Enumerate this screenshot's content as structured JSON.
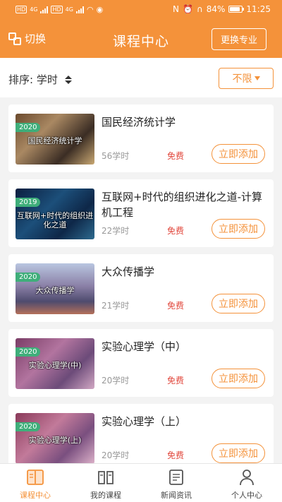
{
  "status_bar": {
    "left_network_labels": [
      "HD",
      "4G",
      "HD",
      "4G"
    ],
    "battery": "84%",
    "time": "11:25"
  },
  "header": {
    "switch_label": "切换",
    "title": "课程中心",
    "change_major_label": "更换专业"
  },
  "sort": {
    "label": "排序: 学时",
    "filter_label": "不限"
  },
  "courses": [
    {
      "year": "2020",
      "thumb_text": "国民经济统计学",
      "title": "国民经济统计学",
      "hours": "56学时",
      "price": "免费",
      "action": "立即添加"
    },
    {
      "year": "2019",
      "thumb_text": "互联网+时代的组织进化之道",
      "title": "互联网+时代的组织进化之道-计算机工程",
      "hours": "22学时",
      "price": "免费",
      "action": "立即添加"
    },
    {
      "year": "2020",
      "thumb_text": "大众传播学",
      "title": "大众传播学",
      "hours": "21学时",
      "price": "免费",
      "action": "立即添加"
    },
    {
      "year": "2020",
      "thumb_text": "实验心理学(中)",
      "title": "实验心理学（中）",
      "hours": "20学时",
      "price": "免费",
      "action": "立即添加"
    },
    {
      "year": "2020",
      "thumb_text": "实验心理学(上)",
      "title": "实验心理学（上）",
      "hours": "20学时",
      "price": "免费",
      "action": "立即添加"
    }
  ],
  "tabs": [
    {
      "label": "课程中心",
      "icon": "book-open-icon",
      "active": true
    },
    {
      "label": "我的课程",
      "icon": "books-icon",
      "active": false
    },
    {
      "label": "新闻资讯",
      "icon": "news-icon",
      "active": false
    },
    {
      "label": "个人中心",
      "icon": "person-icon",
      "active": false
    }
  ],
  "colors": {
    "accent": "#f4923a",
    "free": "#e1463b",
    "year_tag": "#3fae7a"
  }
}
